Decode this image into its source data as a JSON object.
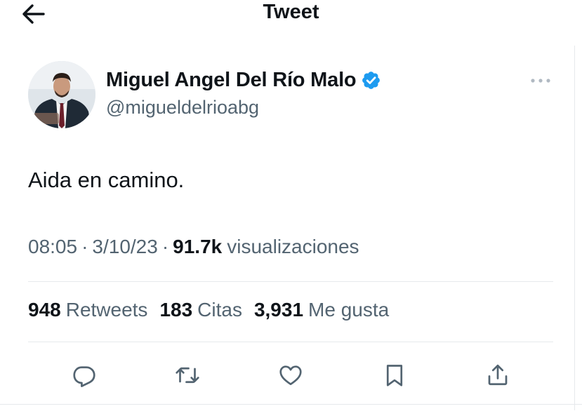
{
  "header": {
    "title": "Tweet",
    "back_icon": "arrow-left-icon"
  },
  "author": {
    "name": "Miguel Angel Del Río Malo",
    "handle": "@migueldelrioabg",
    "verified": true,
    "verified_color": "#1d9bf0"
  },
  "tweet": {
    "text": "Aida en camino.",
    "time": "08:05",
    "date": "3/10/23",
    "views_count": "91.7k",
    "views_label": "visualizaciones"
  },
  "stats": [
    {
      "count": "948",
      "label": "Retweets"
    },
    {
      "count": "183",
      "label": "Citas"
    },
    {
      "count": "3,931",
      "label": "Me gusta"
    }
  ],
  "actions": [
    "reply-icon",
    "retweet-icon",
    "like-icon",
    "bookmark-icon",
    "share-icon"
  ],
  "colors": {
    "text": "#0f1419",
    "secondary": "#536471",
    "divider": "#e6e9ec",
    "accent": "#1d9bf0"
  }
}
